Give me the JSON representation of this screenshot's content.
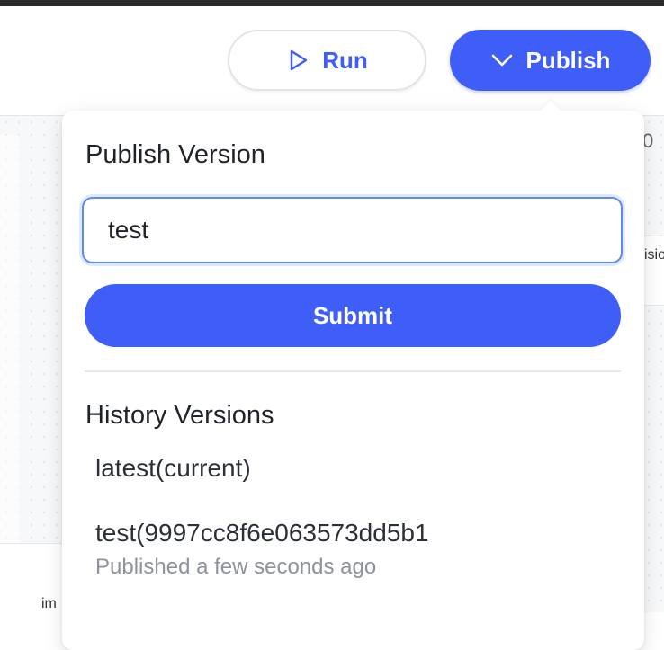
{
  "toolbar": {
    "run_label": "Run",
    "publish_label": "Publish",
    "run_icon": "play-icon",
    "publish_icon": "chevron-down-icon",
    "accent_color": "#3f5ef7"
  },
  "canvas": {
    "bottom_node_text": "im",
    "right_node_text": "isio",
    "right_top_fragment": "0"
  },
  "publish_panel": {
    "title": "Publish Version",
    "version_input_value": "test",
    "submit_label": "Submit",
    "history_title": "History Versions",
    "history": [
      {
        "name": "latest(current)",
        "meta": ""
      },
      {
        "name": "test(9997cc8f6e063573dd5b1",
        "meta": "Published a few seconds ago"
      }
    ]
  }
}
